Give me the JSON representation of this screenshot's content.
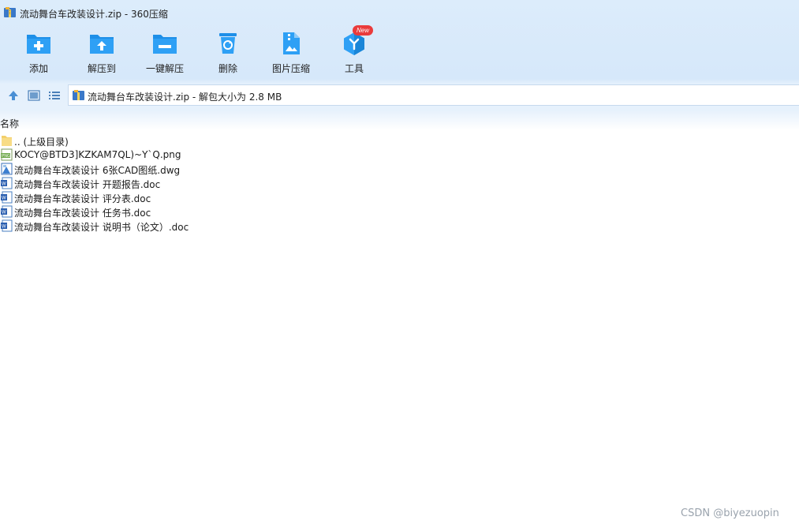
{
  "window": {
    "title": "流动舞台车改装设计.zip - 360压缩",
    "app_icon": "zip-archive-icon"
  },
  "toolbar": {
    "buttons": [
      {
        "label": "添加",
        "icon": "add-folder-icon"
      },
      {
        "label": "解压到",
        "icon": "extract-to-folder-icon"
      },
      {
        "label": "一键解压",
        "icon": "one-click-extract-icon"
      },
      {
        "label": "删除",
        "icon": "recycle-bin-icon"
      },
      {
        "label": "图片压缩",
        "icon": "image-compress-icon"
      },
      {
        "label": "工具",
        "icon": "tools-hexagon-icon",
        "badge": "New"
      }
    ]
  },
  "navbar": {
    "icons": [
      "up-arrow-icon",
      "thumbnail-view-icon",
      "list-view-icon"
    ],
    "address_text": "流动舞台车改装设计.zip - 解包大小为 2.8 MB"
  },
  "file_list": {
    "column_header": "名称",
    "items": [
      {
        "name": ".. (上级目录)",
        "icon": "folder-icon"
      },
      {
        "name": "KOCY@BTD3]KZKAM7QL)~Y`Q.png",
        "icon": "png-file-icon"
      },
      {
        "name": "流动舞台车改装设计 6张CAD图纸.dwg",
        "icon": "dwg-file-icon"
      },
      {
        "name": "流动舞台车改装设计 开题报告.doc",
        "icon": "word-doc-icon"
      },
      {
        "name": "流动舞台车改装设计 评分表.doc",
        "icon": "word-doc-icon"
      },
      {
        "name": "流动舞台车改装设计 任务书.doc",
        "icon": "word-doc-icon"
      },
      {
        "name": "流动舞台车改装设计 说明书（论文）.doc",
        "icon": "word-doc-icon"
      }
    ]
  },
  "watermark": "CSDN @biyezuopin",
  "colors": {
    "accent_blue": "#1e8fe8",
    "badge_red": "#ea3b3b",
    "chrome_bg": "#dcecfb"
  }
}
